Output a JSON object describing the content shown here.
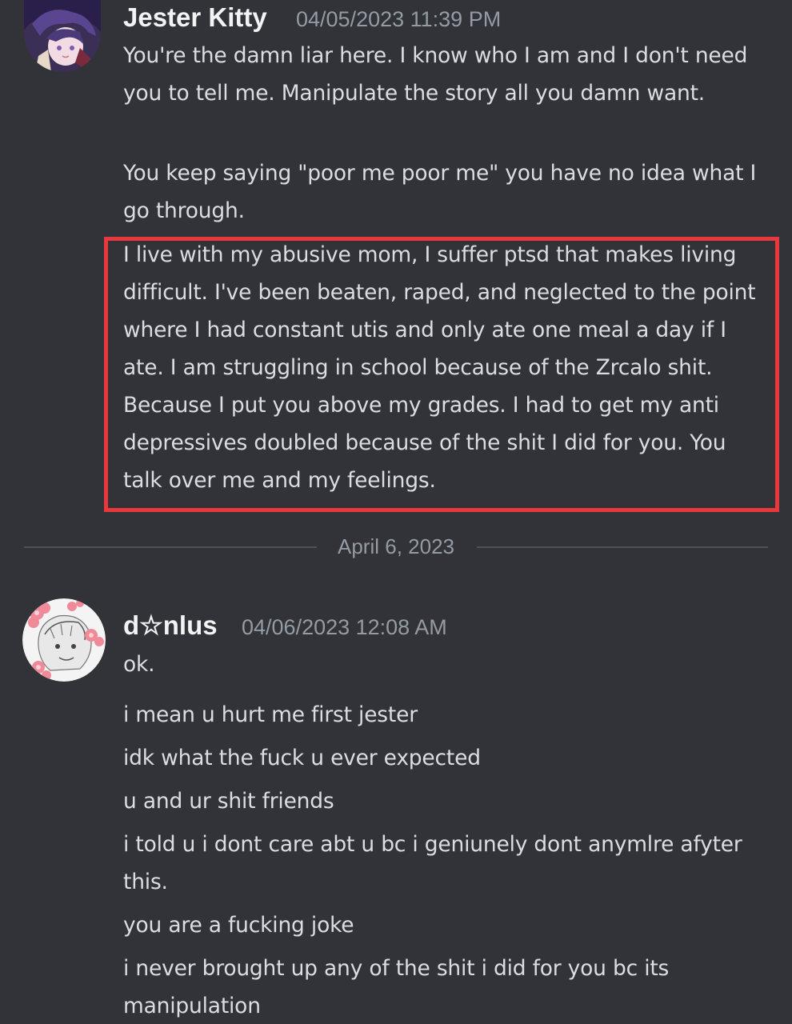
{
  "theme": {
    "background": "#313338",
    "text": "#dbdee1",
    "username": "#f2f3f5",
    "timestamp": "#949ba4",
    "highlight": "#e8383b"
  },
  "messages_group_1": {
    "username": "Jester Kitty",
    "timestamp": "04/05/2023 11:39 PM",
    "avatar_icon": "anime-avatar-icon",
    "lines": [
      "You're the damn liar here. I know who I am and I don't need you to tell me. Manipulate the story all you damn want.",
      "You keep saying \"poor me poor me\" you have no idea what I go through.",
      "I live with my abusive mom, I suffer ptsd that makes living difficult. I've been beaten, raped, and neglected to the point where I had constant utis and only ate one meal a day if I ate. I am struggling in school because of the Zrcalo shit. Because I put you above my grades. I had to get my anti depressives doubled because of the shit I did for you. You talk over me and my feelings."
    ]
  },
  "date_divider": "April 6, 2023",
  "messages_group_2": {
    "username": "d☆nlus",
    "timestamp": "04/06/2023 12:08 AM",
    "avatar_icon": "sketch-avatar-with-flowers-icon",
    "lines": [
      "ok.",
      "i mean u hurt me first jester",
      "idk what the fuck u ever expected",
      "u and ur shit friends",
      "i told u i dont care abt u bc i geniunely dont anymlre afyter this.",
      "you are a fucking joke",
      "i never brought up any of the shit i did for you bc its manipulation"
    ]
  }
}
